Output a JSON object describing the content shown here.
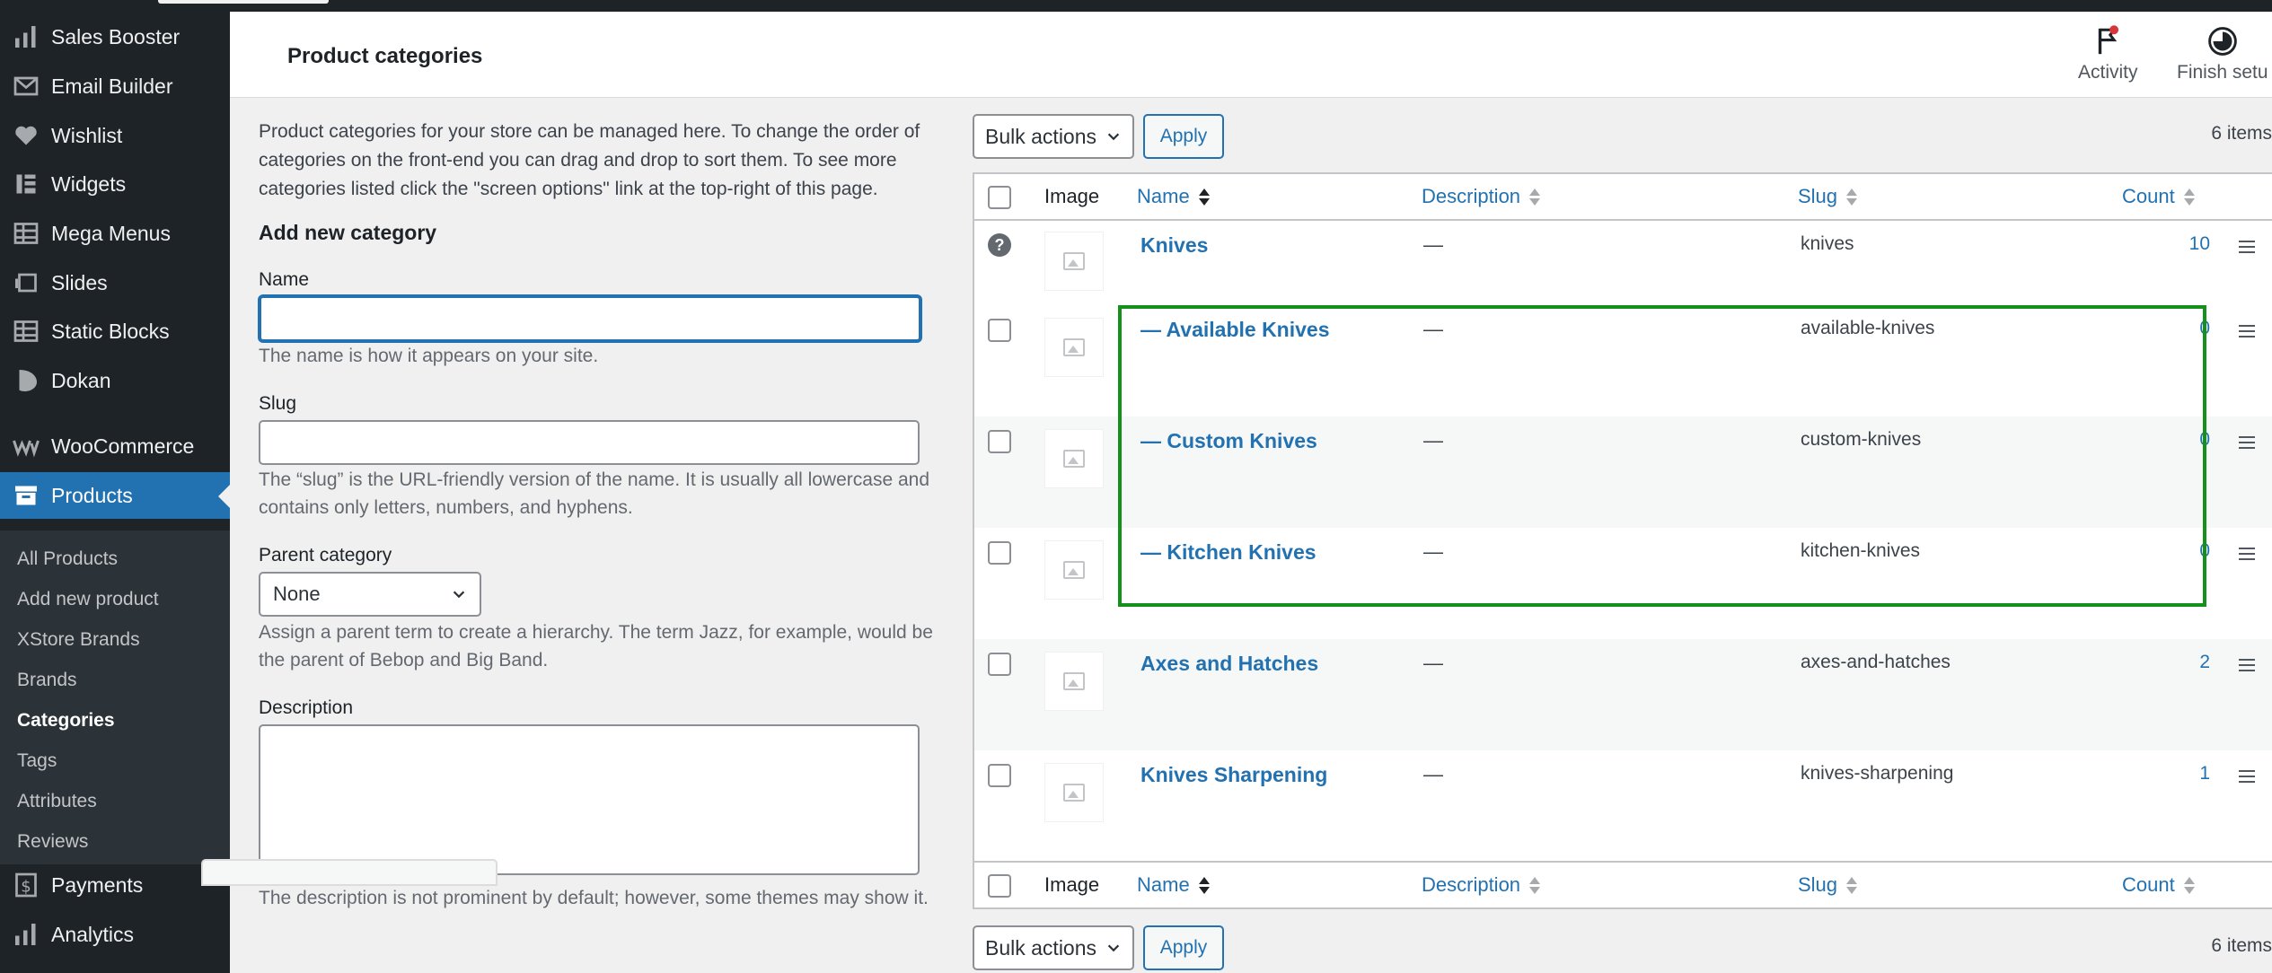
{
  "header": {
    "title": "Product categories",
    "activity_label": "Activity",
    "finish_setup_label": "Finish setu"
  },
  "sidebar": {
    "items": [
      {
        "label": "Sales Booster",
        "icon": "bar-chart-icon"
      },
      {
        "label": "Email Builder",
        "icon": "envelope-icon"
      },
      {
        "label": "Wishlist",
        "icon": "heart-icon"
      },
      {
        "label": "Widgets",
        "icon": "widgets-icon"
      },
      {
        "label": "Mega Menus",
        "icon": "grid-icon"
      },
      {
        "label": "Slides",
        "icon": "slides-icon"
      },
      {
        "label": "Static Blocks",
        "icon": "grid-icon"
      },
      {
        "label": "Dokan",
        "icon": "dokan-icon"
      },
      {
        "label": "WooCommerce",
        "icon": "woo-icon"
      },
      {
        "label": "Products",
        "icon": "archive-icon"
      }
    ],
    "submenu": [
      "All Products",
      "Add new product",
      "XStore Brands",
      "Brands",
      "Categories",
      "Tags",
      "Attributes",
      "Reviews"
    ],
    "bottom": [
      {
        "label": "Payments",
        "icon": "dollar-icon"
      },
      {
        "label": "Analytics",
        "icon": "bar-chart-icon"
      }
    ]
  },
  "form": {
    "intro": "Product categories for your store can be managed here. To change the order of categories on the front-end you can drag and drop to sort them. To see more categories listed click the \"screen options\" link at the top-right of this page.",
    "heading": "Add new category",
    "name_label": "Name",
    "name_value": "",
    "name_help": "The name is how it appears on your site.",
    "slug_label": "Slug",
    "slug_value": "",
    "slug_help": "The “slug” is the URL-friendly version of the name. It is usually all lowercase and contains only letters, numbers, and hyphens.",
    "parent_label": "Parent category",
    "parent_value": "None",
    "parent_help": "Assign a parent term to create a hierarchy. The term Jazz, for example, would be the parent of Bebop and Big Band.",
    "description_label": "Description",
    "description_value": "",
    "description_help": "The description is not prominent by default; however, some themes may show it."
  },
  "table": {
    "bulk_actions": "Bulk actions",
    "apply": "Apply",
    "items_count": "6 items",
    "columns": {
      "image": "Image",
      "name": "Name",
      "description": "Description",
      "slug": "Slug",
      "count": "Count"
    },
    "rows": [
      {
        "name": "Knives",
        "description": "—",
        "slug": "knives",
        "count": "10"
      },
      {
        "name": "— Available Knives",
        "description": "—",
        "slug": "available-knives",
        "count": "0"
      },
      {
        "name": "— Custom Knives",
        "description": "—",
        "slug": "custom-knives",
        "count": "0"
      },
      {
        "name": "— Kitchen Knives",
        "description": "—",
        "slug": "kitchen-knives",
        "count": "0"
      },
      {
        "name": "Axes and Hatches",
        "description": "—",
        "slug": "axes-and-hatches",
        "count": "2"
      },
      {
        "name": "Knives Sharpening",
        "description": "—",
        "slug": "knives-sharpening",
        "count": "1"
      }
    ]
  },
  "colors": {
    "accent": "#2271b1",
    "highlight": "#15901b",
    "sidebar": "#1d2327"
  }
}
